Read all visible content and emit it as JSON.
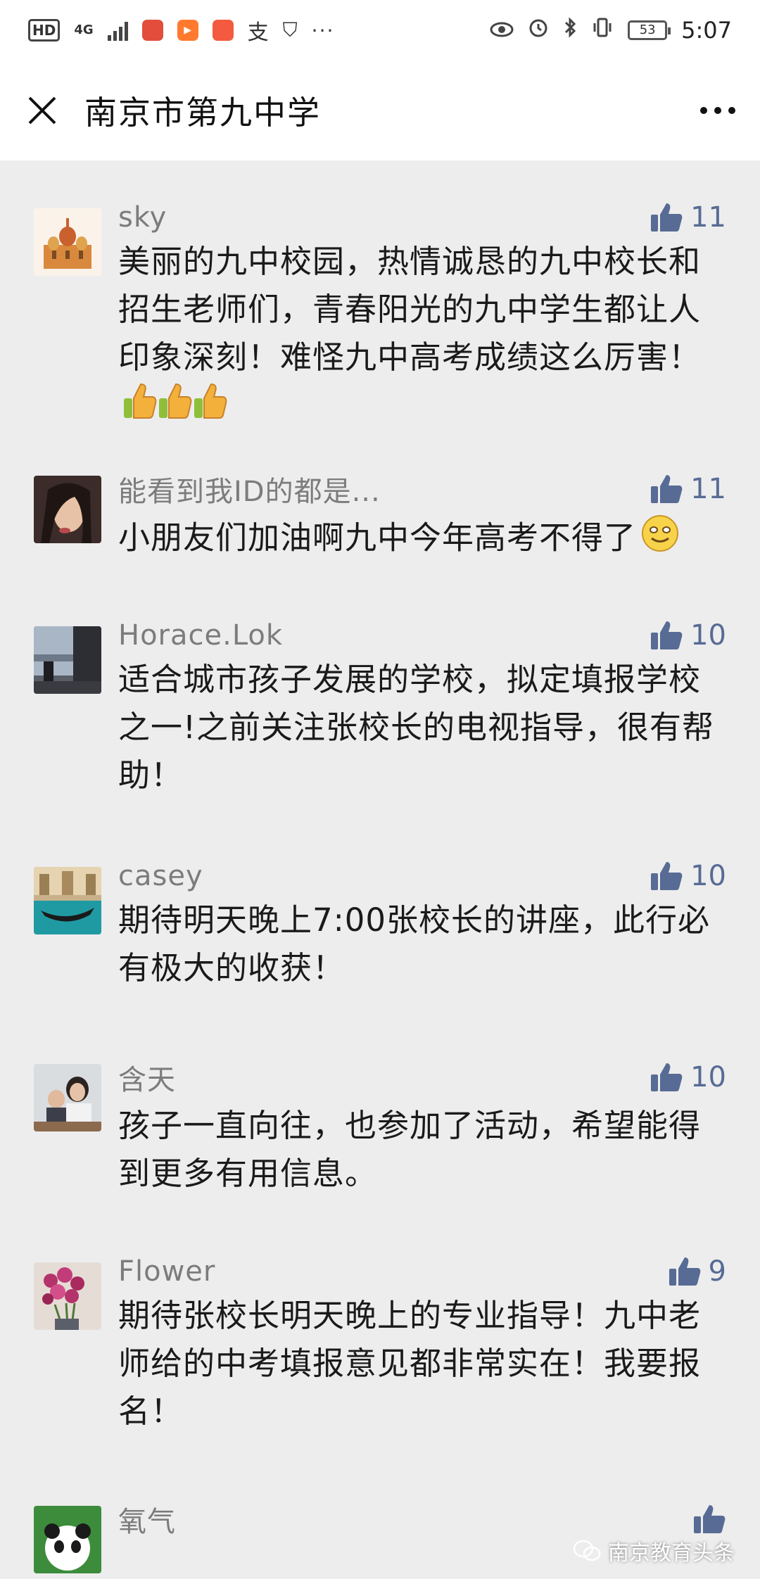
{
  "status_bar": {
    "hd_label": "HD",
    "network_label": "4G",
    "battery": "53",
    "time": "5:07",
    "more": "···"
  },
  "titlebar": {
    "title": "南京市第九中学"
  },
  "comments": [
    {
      "nickname": "sky",
      "likes": "11",
      "text": "美丽的九中校园，热情诚恳的九中校长和招生老师们，青春阳光的九中学生都让人印象深刻！难怪九中高考成绩这么厉害！"
    },
    {
      "nickname": "能看到我ID的都是...",
      "likes": "11",
      "text": "小朋友们加油啊九中今年高考不得了"
    },
    {
      "nickname": "Horace.Lok",
      "likes": "10",
      "text": "适合城市孩子发展的学校，拟定填报学校之一!之前关注张校长的电视指导，很有帮助！"
    },
    {
      "nickname": "casey",
      "likes": "10",
      "text": "期待明天晚上7:00张校长的讲座，此行必有极大的收获！"
    },
    {
      "nickname": "含天",
      "likes": "10",
      "text": "孩子一直向往，也参加了活动，希望能得到更多有用信息。"
    },
    {
      "nickname": "Flower",
      "likes": "9",
      "text": "期待张校长明天晚上的专业指导！九中老师给的中考填报意见都非常实在！我要报名！"
    },
    {
      "nickname": "氧气",
      "likes": "",
      "text": ""
    }
  ],
  "watermark": "南京教育头条",
  "colors": {
    "like_blue": "#576b95",
    "background": "#ededed"
  }
}
